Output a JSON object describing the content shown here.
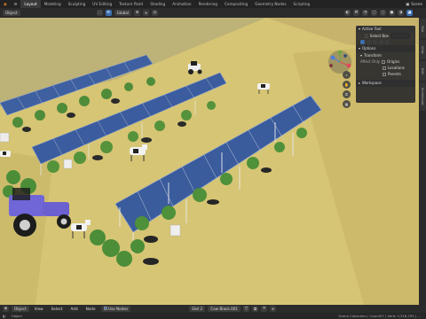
{
  "workspace_tabs": [
    "Layout",
    "Modeling",
    "Sculpting",
    "UV Editing",
    "Texture Paint",
    "Shading",
    "Animation",
    "Rendering",
    "Compositing",
    "Geometry Nodes",
    "Scripting"
  ],
  "active_tab": "Layout",
  "scene": {
    "label": "Scene"
  },
  "header": {
    "mode": "Object",
    "orientation": "Global",
    "options": "Options"
  },
  "tool_panel": {
    "title": "Active Tool",
    "tool_name": "Select Box",
    "options_section": "Options",
    "transform": "Transform",
    "affect_only": "Affect Only",
    "origins": "Origins",
    "locations": "Locations",
    "parents": "Parents",
    "workspace_section": "Workspace"
  },
  "right_tabs": [
    "Tool",
    "View",
    "Edit",
    "Screencast"
  ],
  "statusbar": {
    "mode": "Object",
    "menus": [
      "View",
      "Select",
      "Add",
      "Node"
    ],
    "use_nodes": "Use Nodes",
    "slot": "Slot 2",
    "material": "Cow Black.001",
    "info_left": "Object",
    "info_right": "Scene Collection | Cow.007 | Verts 3,316,793 | ..."
  },
  "colors": {
    "ground": "#d9c777",
    "panel": "#2c2c2c",
    "accent": "#3c6fb0",
    "solar": "#4a6aa8"
  }
}
